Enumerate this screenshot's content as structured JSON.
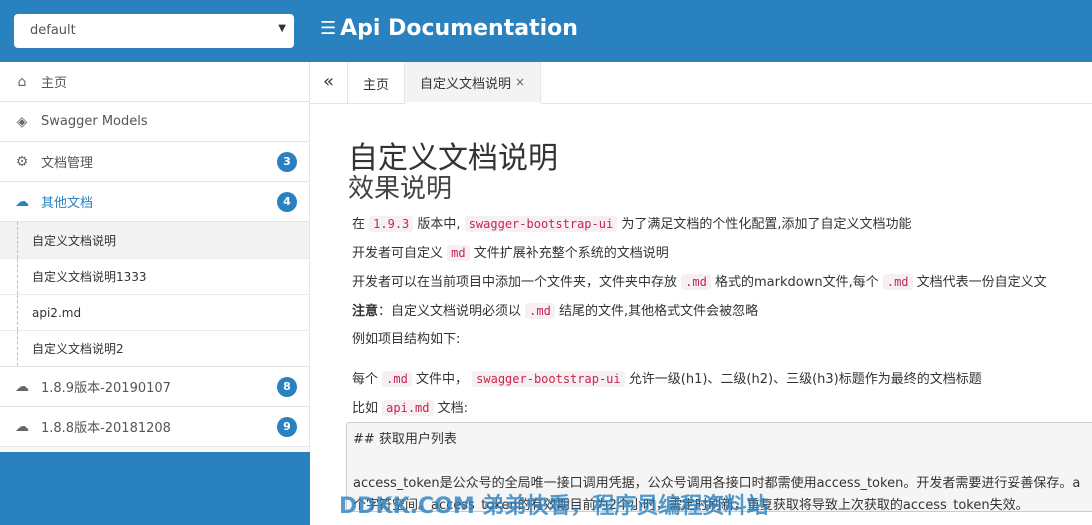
{
  "header": {
    "group_select_value": "default",
    "brand_title": "Api Documentation"
  },
  "sidebar": {
    "items": [
      {
        "label": "主页",
        "icon": "home-icon"
      },
      {
        "label": "Swagger Models",
        "icon": "cube-icon"
      },
      {
        "label": "文档管理",
        "icon": "settings-icon",
        "badge": "3"
      },
      {
        "label": "其他文档",
        "icon": "cloud-icon",
        "badge": "4"
      },
      {
        "label": "1.8.9版本-20190107",
        "icon": "cloud-icon",
        "badge": "8"
      },
      {
        "label": "1.8.8版本-20181208",
        "icon": "cloud-icon",
        "badge": "9"
      }
    ],
    "submenu": [
      "自定义文档说明",
      "自定义文档说明1333",
      "api2.md",
      "自定义文档说明2"
    ]
  },
  "tabs": {
    "collapse": "«",
    "items": [
      "主页",
      "自定义文档说明"
    ],
    "close": "×"
  },
  "doc": {
    "title": "自定义文档说明",
    "subtitle": "效果说明",
    "p1": {
      "a": "在",
      "b": "1.9.3",
      "c": "版本中,",
      "d": "swagger-bootstrap-ui",
      "e": "为了满足文档的个性化配置,添加了自定义文档功能"
    },
    "p2": {
      "a": "开发者可自定义",
      "b": "md",
      "c": "文件扩展补充整个系统的文档说明"
    },
    "p3": {
      "a": "开发者可以在当前项目中添加一个文件夹，文件夹中存放",
      "b": ".md",
      "c": "格式的markdown文件,每个",
      "d": ".md",
      "e": "文档代表一份自定义文"
    },
    "p4": {
      "a": "注意",
      "b": "：自定义文档说明必须以",
      "c": ".md",
      "d": "结尾的文件,其他格式文件会被忽略"
    },
    "p5": "例如项目结构如下:",
    "p6": {
      "a": "每个",
      "b": ".md",
      "c": "文件中，",
      "d": "swagger-bootstrap-ui",
      "e": "允许一级(h1)、二级(h2)、三级(h3)标题作为最终的文档标题"
    },
    "p7": {
      "a": "比如",
      "b": "api.md",
      "c": "文档:"
    },
    "pre": {
      "l1": "## 获取用户列表",
      "l2": "access_token是公众号的全局唯一接口调用凭据，公众号调用各接口时都需使用access_token。开发者需要进行妥善保存。a",
      "l3": "个字符空间。access_token的有效期目前为2个小时，需定时刷新，重复获取将导致上次获取的access_token失效。"
    },
    "watermark": "DDKK.COM 弟弟快看，程序员编程资料站"
  }
}
